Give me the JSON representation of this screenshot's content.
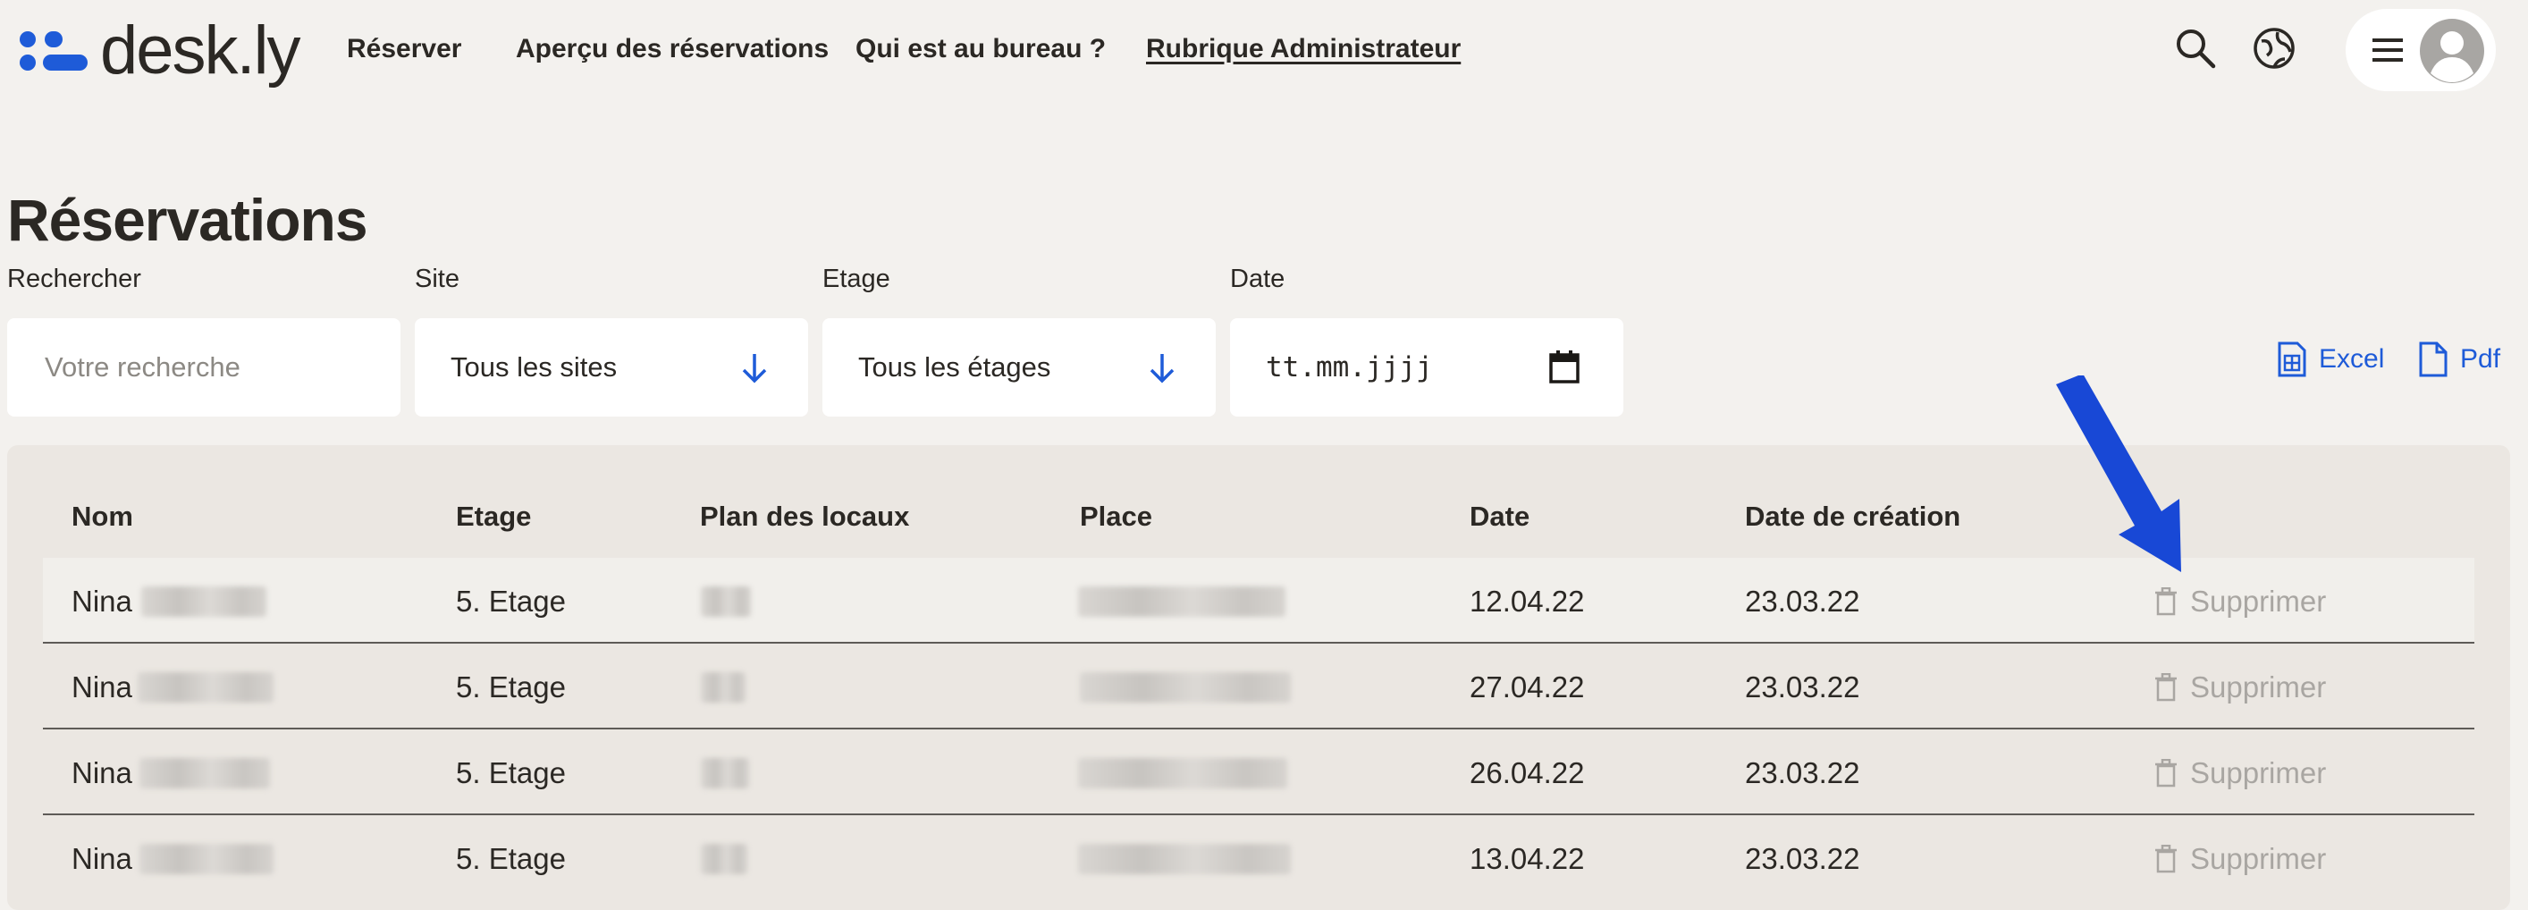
{
  "brand": {
    "name": "desk.ly",
    "color": "#1e5bd8"
  },
  "nav": [
    {
      "label": "Réserver"
    },
    {
      "label": "Aperçu des réservations"
    },
    {
      "label": "Qui est au bureau ?"
    },
    {
      "label": "Rubrique Administrateur",
      "active": true
    }
  ],
  "header_icons": [
    "search-icon",
    "globe-icon",
    "menu-icon",
    "avatar-icon"
  ],
  "page": {
    "title": "Réservations"
  },
  "filters": {
    "search": {
      "label": "Rechercher",
      "placeholder": "Votre recherche"
    },
    "site": {
      "label": "Site",
      "value": "Tous les sites"
    },
    "floor": {
      "label": "Etage",
      "value": "Tous les étages"
    },
    "date": {
      "label": "Date",
      "value": "tt.mm.jjjj"
    }
  },
  "exports": {
    "excel": "Excel",
    "pdf": "Pdf"
  },
  "table": {
    "columns": [
      "Nom",
      "Etage",
      "Plan des locaux",
      "Place",
      "Date",
      "Date de création"
    ],
    "action_label": "Supprimer",
    "rows": [
      {
        "name": "Nina",
        "floor": "5. Etage",
        "date": "12.04.22",
        "created": "23.03.22"
      },
      {
        "name": "Nina",
        "floor": "5. Etage",
        "date": "27.04.22",
        "created": "23.03.22"
      },
      {
        "name": "Nina",
        "floor": "5. Etage",
        "date": "26.04.22",
        "created": "23.03.22"
      },
      {
        "name": "Nina",
        "floor": "5. Etage",
        "date": "13.04.22",
        "created": "23.03.22"
      }
    ]
  },
  "colors": {
    "accent": "#1e5bd8",
    "background": "#f3f1ee",
    "table_bg": "#ebe7e2",
    "muted": "#a9a6a2"
  }
}
